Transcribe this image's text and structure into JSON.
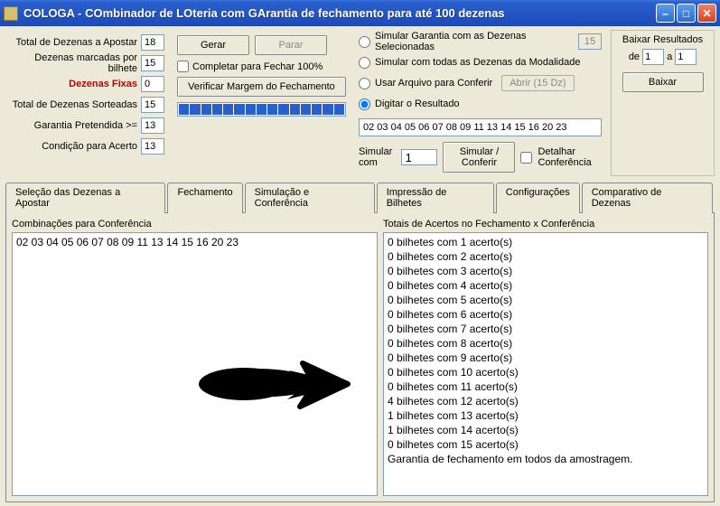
{
  "window": {
    "title": "COLOGA - COmbinador de LOteria com GArantia de fechamento para até 100 dezenas"
  },
  "fields": {
    "total_dezenas_apostar": {
      "label": "Total de Dezenas a Apostar",
      "value": "18"
    },
    "dezenas_por_bilhete": {
      "label": "Dezenas marcadas por bilhete",
      "value": "15"
    },
    "dezenas_fixas": {
      "label": "Dezenas Fixas",
      "value": "0"
    },
    "total_sorteadas": {
      "label": "Total de Dezenas Sorteadas",
      "value": "15"
    },
    "garantia": {
      "label": "Garantia Pretendida >=",
      "value": "13"
    },
    "condicao_acerto": {
      "label": "Condição para Acerto",
      "value": "13"
    }
  },
  "buttons": {
    "gerar": "Gerar",
    "parar": "Parar",
    "completar": "Completar para Fechar 100%",
    "verificar": "Verificar Margem do Fechamento",
    "abrir15dz": "Abrir (15 Dz)",
    "simular_conferir": "Simular / Conferir",
    "baixar_resultados": "Baixar Resultados",
    "baixar": "Baixar"
  },
  "radios": {
    "simular_selecionadas": {
      "label": "Simular Garantia com as Dezenas Selecionadas",
      "value": "15"
    },
    "simular_todas": {
      "label": "Simular com todas as Dezenas da Modalidade"
    },
    "usar_arquivo": {
      "label": "Usar Arquivo para Conferir"
    },
    "digitar": {
      "label": "Digitar o Resultado"
    }
  },
  "digitado": "02 03 04 05 06 07 08 09 11 13 14 15 16 20 23",
  "simular_com": {
    "label": "Simular com",
    "value": "1"
  },
  "detalhar": "Detalhar Conferência",
  "download": {
    "de": "de",
    "a": "a",
    "from": "1",
    "to": "1"
  },
  "tabs": {
    "selecao": "Seleção das Dezenas a Apostar",
    "fechamento": "Fechamento",
    "simulacao": "Simulação e Conferência",
    "impressao": "Impressão de Bilhetes",
    "config": "Configurações",
    "comparativo": "Comparativo de Dezenas"
  },
  "col_headers": {
    "left": "Combinações para Conferência",
    "right": "Totais de Acertos no Fechamento x Conferência"
  },
  "combinacoes": [
    "02 03 04 05 06 07 08 09 11 13 14 15 16 20 23"
  ],
  "resultados": [
    "0 bilhetes com 1 acerto(s)",
    "0 bilhetes com 2 acerto(s)",
    "0 bilhetes com 3 acerto(s)",
    "0 bilhetes com 4 acerto(s)",
    "0 bilhetes com 5 acerto(s)",
    "0 bilhetes com 6 acerto(s)",
    "0 bilhetes com 7 acerto(s)",
    "0 bilhetes com 8 acerto(s)",
    "0 bilhetes com 9 acerto(s)",
    "0 bilhetes com 10 acerto(s)",
    "0 bilhetes com 11 acerto(s)",
    "4 bilhetes com 12 acerto(s)",
    "1 bilhetes com 13 acerto(s)",
    "1 bilhetes com 14 acerto(s)",
    "0 bilhetes com 15 acerto(s)",
    "Garantia de fechamento em todos da amostragem."
  ]
}
